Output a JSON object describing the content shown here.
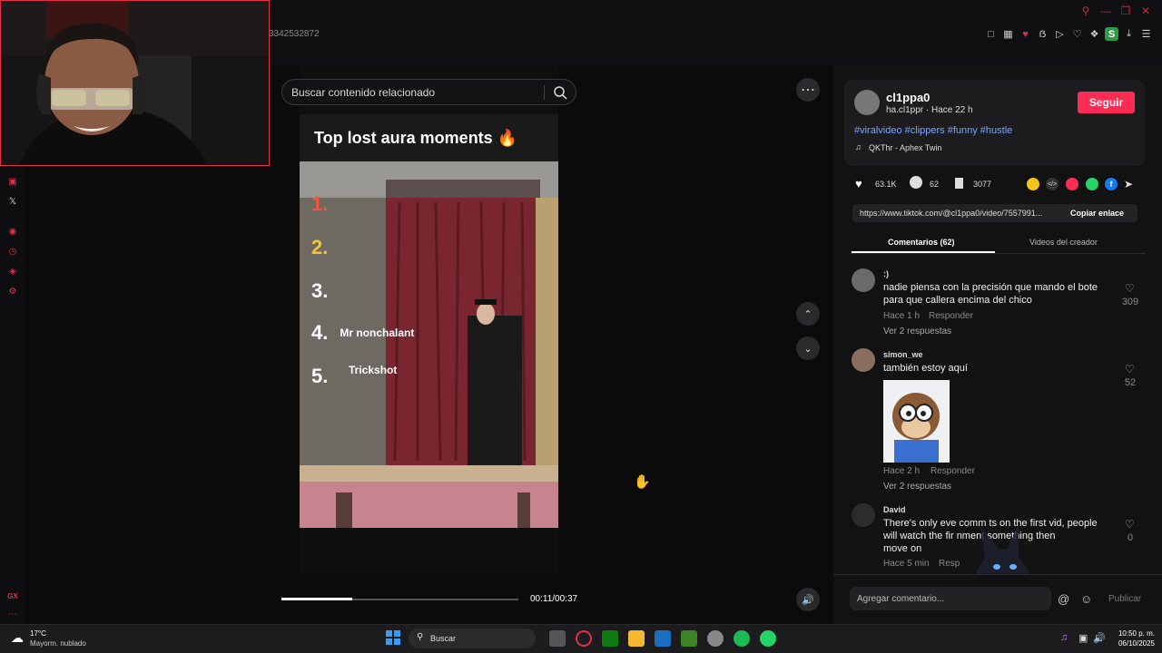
{
  "browser": {
    "address_fragment": "3342532872"
  },
  "video": {
    "search_placeholder": "Buscar contenido relacionado",
    "title": "Top lost aura moments 🔥",
    "list": [
      {
        "num": "1.",
        "text": "",
        "color": "#f2553a"
      },
      {
        "num": "2.",
        "text": "",
        "color": "#f5c430"
      },
      {
        "num": "3.",
        "text": "",
        "color": "#ffffff"
      },
      {
        "num": "4.",
        "text": "Mr nonchalant",
        "color": "#ffffff"
      },
      {
        "num": "5.",
        "text": "Trickshot",
        "color": "#ffffff"
      }
    ],
    "time": "00:11/00:37",
    "progress": 0.297
  },
  "creator": {
    "name": "cl1ppa0",
    "handle_time": "ha.cl1ppr · Hace 22 h",
    "follow_label": "Seguir",
    "hashtags": "#viralvideo #clippers #funny #hustle",
    "music": "QKThr - Aphex Twin"
  },
  "stats": {
    "likes": "63.1K",
    "comments": "62",
    "saves": "3077"
  },
  "share": {
    "url": "https://www.tiktok.com/@cl1ppa0/video/7557991...",
    "copy_label": "Copiar enlace"
  },
  "tabs": {
    "comments": "Comentarios (62)",
    "creator_videos": "Videos del creador"
  },
  "comments": [
    {
      "name": ":)",
      "text_1": "nadie piensa con la precisión que mando el bote",
      "text_2": "para que callera encima del chico",
      "time": "Hace 1 h",
      "reply": "Responder",
      "replies": "Ver 2 respuestas",
      "likes": "309"
    },
    {
      "name": "simon_we",
      "text_1": "también estoy aquí",
      "time": "Hace 2 h",
      "reply": "Responder",
      "replies": "Ver 2 respuestas",
      "likes": "52"
    },
    {
      "name": "David",
      "text_1": "There's only eve   comm   ts on the first vid, people",
      "text_2": "will watch the fir        nment something then",
      "text_3": "move on",
      "time": "Hace 5 min",
      "reply": "Resp",
      "likes": "0"
    }
  ],
  "comment_box": {
    "placeholder": "Agregar comentario...",
    "post_label": "Publicar"
  },
  "taskbar": {
    "weather_temp": "17°C",
    "weather_desc": "Mayorm. nublado",
    "search_label": "Buscar",
    "time": "10:50 p. m.",
    "date": "06/10/2025"
  },
  "colors": {
    "accent": "#fe2c55",
    "gx_red": "#e0304a",
    "hashtag": "#7aa7ff"
  }
}
